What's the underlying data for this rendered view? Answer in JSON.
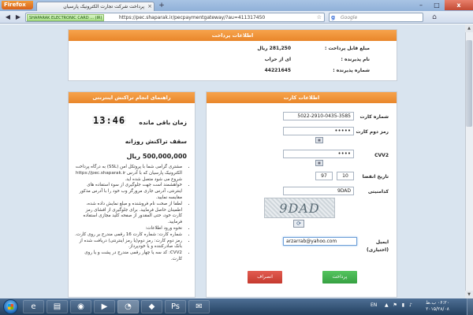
{
  "browser": {
    "app_button": "Firefox",
    "tab_title": "پرداخت شرکت تجارت الکترونیک پارسیان",
    "tab_close": "×",
    "new_tab": "+",
    "site_identity": "SHAPARAK ELECTRONIC CARD ... (IR)",
    "url": "https://pec.shaparak.ir/pecpaymentgateway/?au=411317450",
    "search_placeholder": "Google",
    "window_buttons": {
      "minimize": "–",
      "maximize": "□",
      "close": "x"
    }
  },
  "payment_info": {
    "header": "اطلاعات پرداخت",
    "rows": [
      {
        "label": "مبلغ قابل پرداخت :",
        "value": "281,250 ریال"
      },
      {
        "label": "نام پذیرنده :",
        "value": "ای از حراب"
      },
      {
        "label": "شماره پذیرنده :",
        "value": "44221645"
      }
    ]
  },
  "card_info": {
    "header": "اطلاعات کارت",
    "card_number_label": "شماره کارت",
    "card_number_value": "5022-2910-0435-3585",
    "pin2_label": "رمز دوم کارت",
    "pin2_value": "•••••",
    "cvv2_label": "CVV2",
    "cvv2_value": "••••",
    "expiry_label": "تاریخ انقضا",
    "expiry_month": "10",
    "expiry_year": "97",
    "security_code_label": "کدامنیتی",
    "security_code_value": "9DAD",
    "captcha_text": "9DAD",
    "email_label": "ایمیل",
    "email_optional": "(اختیاری)",
    "email_value": "arzarrab@yahoo.com",
    "pay_button": "پرداخت",
    "cancel_button": "انصراف"
  },
  "guide": {
    "header": "راهنمای انجام تراکنش اینترنتی",
    "timer_label": "زمان باقی مانده",
    "timer_value": "13:46",
    "limit_label": "سقف تراکنش روزانه",
    "limit_amount": "500,000,000 ریال",
    "items": [
      "مشتری گرامی شما با پروتکل امن (SSL) به درگاه پرداخت الکترونیک پارسیان که با آدرس https://pec.shaparak.ir شروع می شود متصل شده اید.",
      "خواهشمند است جهت جلوگیری از سوء استفاده های اینترنتی، آدرس جاری مرورگر وب خود را با آدرس مذکور مقایسه نمایید.",
      "لطفا از صحت نام فروشنده و مبلغ نمایش داده شده، اطمینان حاصل فرمایید. برای جلوگیری از افشای رمز کارت خود، حتی المقدور از صفحه کلید مجازی استفاده فرمایید.",
      "نحوه ورود اطلاعات:",
      "شماره کارت: شماره کارت 16 رقمی مندرج بر روی کارت.",
      "رمز دوم کارت: رمز دوم(یا رمز اینترنتی) دریافت شده از بانک صادرکننده و یا خودپرداز.",
      "CVV2: کد سه یا چهار رقمی مندرج در پشت و یا روی کارت."
    ]
  },
  "taskbar": {
    "language": "EN",
    "time": "۰۶:۲۰ ب.ظ",
    "date": "۲۰۱۵/۲۸/۰۸"
  }
}
